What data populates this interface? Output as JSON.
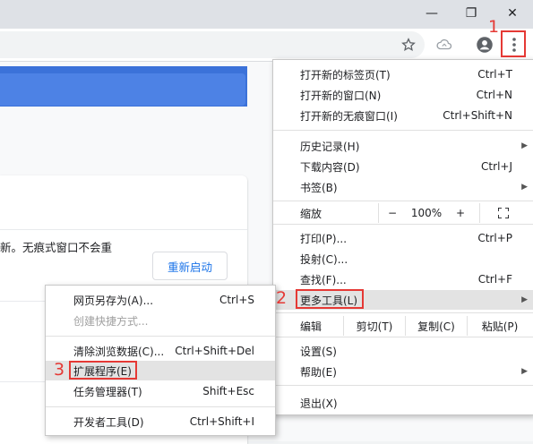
{
  "window": {
    "minimize_glyph": "—",
    "restore_glyph": "❐",
    "close_glyph": "✕"
  },
  "toolbar": {
    "icons": [
      "star-icon",
      "cloud-extension-icon",
      "profile-avatar-icon",
      "more-menu-icon"
    ]
  },
  "page": {
    "notice_text": "新。无痕式窗口不会重",
    "restart_button": "重新启动"
  },
  "main_menu": {
    "items": [
      {
        "label": "打开新的标签页(T)",
        "shortcut": "Ctrl+T"
      },
      {
        "label": "打开新的窗口(N)",
        "shortcut": "Ctrl+N"
      },
      {
        "label": "打开新的无痕窗口(I)",
        "shortcut": "Ctrl+Shift+N"
      },
      {
        "label": "历史记录(H)",
        "shortcut": ""
      },
      {
        "label": "下载内容(D)",
        "shortcut": "Ctrl+J"
      },
      {
        "label": "书签(B)",
        "shortcut": ""
      },
      {
        "label": "打印(P)...",
        "shortcut": "Ctrl+P"
      },
      {
        "label": "投射(C)...",
        "shortcut": ""
      },
      {
        "label": "查找(F)...",
        "shortcut": "Ctrl+F"
      },
      {
        "label": "更多工具(L)",
        "shortcut": ""
      },
      {
        "label": "设置(S)",
        "shortcut": ""
      },
      {
        "label": "帮助(E)",
        "shortcut": ""
      },
      {
        "label": "退出(X)",
        "shortcut": ""
      }
    ],
    "zoom": {
      "label": "缩放",
      "minus": "−",
      "value": "100%",
      "plus": "+"
    },
    "edit": {
      "label": "编辑",
      "cut": "剪切(T)",
      "copy": "复制(C)",
      "paste": "粘贴(P)"
    }
  },
  "sub_menu": {
    "items": [
      {
        "label": "网页另存为(A)...",
        "shortcut": "Ctrl+S"
      },
      {
        "label": "创建快捷方式...",
        "shortcut": ""
      },
      {
        "label": "清除浏览数据(C)...",
        "shortcut": "Ctrl+Shift+Del"
      },
      {
        "label": "扩展程序(E)",
        "shortcut": ""
      },
      {
        "label": "任务管理器(T)",
        "shortcut": "Shift+Esc"
      },
      {
        "label": "开发者工具(D)",
        "shortcut": "Ctrl+Shift+I"
      }
    ]
  },
  "annotations": {
    "step1": "1",
    "step2": "2",
    "step3": "3",
    "color": "#e53935"
  }
}
